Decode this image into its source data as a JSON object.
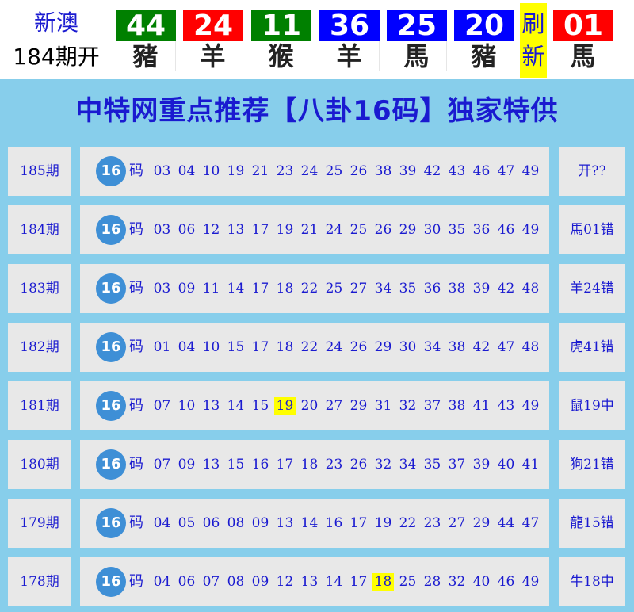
{
  "header": {
    "brand_name": "新澳",
    "current_period": "184期开",
    "balls": [
      {
        "number": "44",
        "zodiac": "豬",
        "color": "#008000"
      },
      {
        "number": "24",
        "zodiac": "羊",
        "color": "#ff0000"
      },
      {
        "number": "11",
        "zodiac": "猴",
        "color": "#008000"
      },
      {
        "number": "36",
        "zodiac": "羊",
        "color": "#0000ff"
      },
      {
        "number": "25",
        "zodiac": "馬",
        "color": "#0000ff"
      },
      {
        "number": "20",
        "zodiac": "豬",
        "color": "#0000ff"
      },
      {
        "number": "01",
        "zodiac": "馬",
        "color": "#ff0000"
      }
    ],
    "refresh_line1": "刷",
    "refresh_line2": "新"
  },
  "title": "中特网重点推荐【八卦16码】独家特供",
  "badge_label": "16",
  "ma_label": "码",
  "rows": [
    {
      "period": "185期",
      "numbers": [
        "03",
        "04",
        "10",
        "19",
        "21",
        "23",
        "24",
        "25",
        "26",
        "38",
        "39",
        "42",
        "43",
        "46",
        "47",
        "49"
      ],
      "highlight": "",
      "result": "开??"
    },
    {
      "period": "184期",
      "numbers": [
        "03",
        "06",
        "12",
        "13",
        "17",
        "19",
        "21",
        "24",
        "25",
        "26",
        "29",
        "30",
        "35",
        "36",
        "46",
        "49"
      ],
      "highlight": "",
      "result": "馬01错"
    },
    {
      "period": "183期",
      "numbers": [
        "03",
        "09",
        "11",
        "14",
        "17",
        "18",
        "22",
        "25",
        "27",
        "34",
        "35",
        "36",
        "38",
        "39",
        "42",
        "48"
      ],
      "highlight": "",
      "result": "羊24错"
    },
    {
      "period": "182期",
      "numbers": [
        "01",
        "04",
        "10",
        "15",
        "17",
        "18",
        "22",
        "24",
        "26",
        "29",
        "30",
        "34",
        "38",
        "42",
        "47",
        "48"
      ],
      "highlight": "",
      "result": "虎41错"
    },
    {
      "period": "181期",
      "numbers": [
        "07",
        "10",
        "13",
        "14",
        "15",
        "19",
        "20",
        "27",
        "29",
        "31",
        "32",
        "37",
        "38",
        "41",
        "43",
        "49"
      ],
      "highlight": "19",
      "result": "鼠19中"
    },
    {
      "period": "180期",
      "numbers": [
        "07",
        "09",
        "13",
        "15",
        "16",
        "17",
        "18",
        "23",
        "26",
        "32",
        "34",
        "35",
        "37",
        "39",
        "40",
        "41"
      ],
      "highlight": "",
      "result": "狗21错"
    },
    {
      "period": "179期",
      "numbers": [
        "04",
        "05",
        "06",
        "08",
        "09",
        "13",
        "14",
        "16",
        "17",
        "19",
        "22",
        "23",
        "27",
        "29",
        "44",
        "47"
      ],
      "highlight": "",
      "result": "龍15错"
    },
    {
      "period": "178期",
      "numbers": [
        "04",
        "06",
        "07",
        "08",
        "09",
        "12",
        "13",
        "14",
        "17",
        "18",
        "25",
        "28",
        "32",
        "40",
        "46",
        "49"
      ],
      "highlight": "18",
      "result": "牛18中"
    }
  ]
}
